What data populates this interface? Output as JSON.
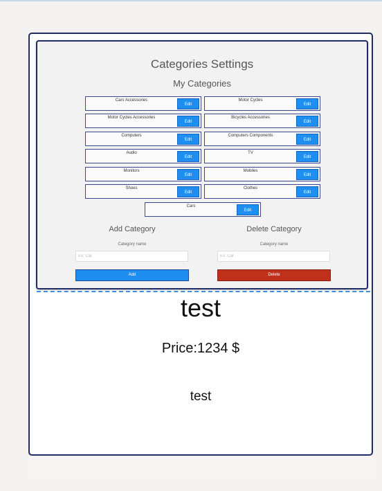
{
  "settings": {
    "title": "Categories Settings",
    "my_categories_title": "My Categories",
    "categories": [
      {
        "label": "Cars Accessories",
        "edit": "Edit"
      },
      {
        "label": "Motor Cycles",
        "edit": "Edit"
      },
      {
        "label": "Motor Cycles Accessories",
        "edit": "Edit"
      },
      {
        "label": "Bicycles Accessories",
        "edit": "Edit"
      },
      {
        "label": "Computers",
        "edit": "Edit"
      },
      {
        "label": "Computers Components",
        "edit": "Edit"
      },
      {
        "label": "Audio",
        "edit": "Edit"
      },
      {
        "label": "TV",
        "edit": "Edit"
      },
      {
        "label": "Monitors",
        "edit": "Edit"
      },
      {
        "label": "Mobiles",
        "edit": "Edit"
      },
      {
        "label": "Shoes",
        "edit": "Edit"
      },
      {
        "label": "Clothes",
        "edit": "Edit"
      },
      {
        "label": "Cars",
        "edit": "Edit"
      }
    ],
    "add": {
      "heading": "Add Category",
      "field_label": "Category name",
      "placeholder": "Ex: Car",
      "button": "Add"
    },
    "delete": {
      "heading": "Delete Category",
      "field_label": "Category name",
      "placeholder": "Ex: Car",
      "button": "Delete"
    }
  },
  "product": {
    "name": "test",
    "price": "Price:1234 $",
    "description": "test"
  },
  "colors": {
    "primary_button": "#1f8ef1",
    "danger_button": "#c0311c",
    "card_border": "#1f2c63"
  }
}
